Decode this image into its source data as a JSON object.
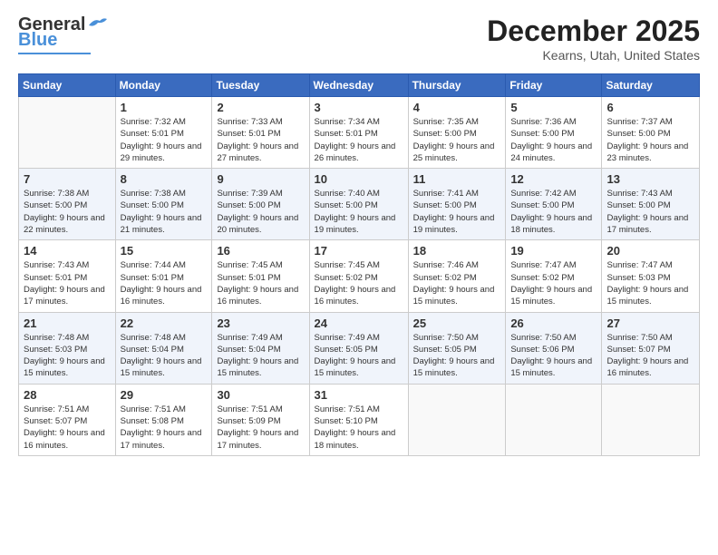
{
  "header": {
    "logo_general": "General",
    "logo_blue": "Blue",
    "month": "December 2025",
    "location": "Kearns, Utah, United States"
  },
  "days_of_week": [
    "Sunday",
    "Monday",
    "Tuesday",
    "Wednesday",
    "Thursday",
    "Friday",
    "Saturday"
  ],
  "weeks": [
    [
      {
        "day": "",
        "sunrise": "",
        "sunset": "",
        "daylight": ""
      },
      {
        "day": "1",
        "sunrise": "Sunrise: 7:32 AM",
        "sunset": "Sunset: 5:01 PM",
        "daylight": "Daylight: 9 hours and 29 minutes."
      },
      {
        "day": "2",
        "sunrise": "Sunrise: 7:33 AM",
        "sunset": "Sunset: 5:01 PM",
        "daylight": "Daylight: 9 hours and 27 minutes."
      },
      {
        "day": "3",
        "sunrise": "Sunrise: 7:34 AM",
        "sunset": "Sunset: 5:01 PM",
        "daylight": "Daylight: 9 hours and 26 minutes."
      },
      {
        "day": "4",
        "sunrise": "Sunrise: 7:35 AM",
        "sunset": "Sunset: 5:00 PM",
        "daylight": "Daylight: 9 hours and 25 minutes."
      },
      {
        "day": "5",
        "sunrise": "Sunrise: 7:36 AM",
        "sunset": "Sunset: 5:00 PM",
        "daylight": "Daylight: 9 hours and 24 minutes."
      },
      {
        "day": "6",
        "sunrise": "Sunrise: 7:37 AM",
        "sunset": "Sunset: 5:00 PM",
        "daylight": "Daylight: 9 hours and 23 minutes."
      }
    ],
    [
      {
        "day": "7",
        "sunrise": "Sunrise: 7:38 AM",
        "sunset": "Sunset: 5:00 PM",
        "daylight": "Daylight: 9 hours and 22 minutes."
      },
      {
        "day": "8",
        "sunrise": "Sunrise: 7:38 AM",
        "sunset": "Sunset: 5:00 PM",
        "daylight": "Daylight: 9 hours and 21 minutes."
      },
      {
        "day": "9",
        "sunrise": "Sunrise: 7:39 AM",
        "sunset": "Sunset: 5:00 PM",
        "daylight": "Daylight: 9 hours and 20 minutes."
      },
      {
        "day": "10",
        "sunrise": "Sunrise: 7:40 AM",
        "sunset": "Sunset: 5:00 PM",
        "daylight": "Daylight: 9 hours and 19 minutes."
      },
      {
        "day": "11",
        "sunrise": "Sunrise: 7:41 AM",
        "sunset": "Sunset: 5:00 PM",
        "daylight": "Daylight: 9 hours and 19 minutes."
      },
      {
        "day": "12",
        "sunrise": "Sunrise: 7:42 AM",
        "sunset": "Sunset: 5:00 PM",
        "daylight": "Daylight: 9 hours and 18 minutes."
      },
      {
        "day": "13",
        "sunrise": "Sunrise: 7:43 AM",
        "sunset": "Sunset: 5:00 PM",
        "daylight": "Daylight: 9 hours and 17 minutes."
      }
    ],
    [
      {
        "day": "14",
        "sunrise": "Sunrise: 7:43 AM",
        "sunset": "Sunset: 5:01 PM",
        "daylight": "Daylight: 9 hours and 17 minutes."
      },
      {
        "day": "15",
        "sunrise": "Sunrise: 7:44 AM",
        "sunset": "Sunset: 5:01 PM",
        "daylight": "Daylight: 9 hours and 16 minutes."
      },
      {
        "day": "16",
        "sunrise": "Sunrise: 7:45 AM",
        "sunset": "Sunset: 5:01 PM",
        "daylight": "Daylight: 9 hours and 16 minutes."
      },
      {
        "day": "17",
        "sunrise": "Sunrise: 7:45 AM",
        "sunset": "Sunset: 5:02 PM",
        "daylight": "Daylight: 9 hours and 16 minutes."
      },
      {
        "day": "18",
        "sunrise": "Sunrise: 7:46 AM",
        "sunset": "Sunset: 5:02 PM",
        "daylight": "Daylight: 9 hours and 15 minutes."
      },
      {
        "day": "19",
        "sunrise": "Sunrise: 7:47 AM",
        "sunset": "Sunset: 5:02 PM",
        "daylight": "Daylight: 9 hours and 15 minutes."
      },
      {
        "day": "20",
        "sunrise": "Sunrise: 7:47 AM",
        "sunset": "Sunset: 5:03 PM",
        "daylight": "Daylight: 9 hours and 15 minutes."
      }
    ],
    [
      {
        "day": "21",
        "sunrise": "Sunrise: 7:48 AM",
        "sunset": "Sunset: 5:03 PM",
        "daylight": "Daylight: 9 hours and 15 minutes."
      },
      {
        "day": "22",
        "sunrise": "Sunrise: 7:48 AM",
        "sunset": "Sunset: 5:04 PM",
        "daylight": "Daylight: 9 hours and 15 minutes."
      },
      {
        "day": "23",
        "sunrise": "Sunrise: 7:49 AM",
        "sunset": "Sunset: 5:04 PM",
        "daylight": "Daylight: 9 hours and 15 minutes."
      },
      {
        "day": "24",
        "sunrise": "Sunrise: 7:49 AM",
        "sunset": "Sunset: 5:05 PM",
        "daylight": "Daylight: 9 hours and 15 minutes."
      },
      {
        "day": "25",
        "sunrise": "Sunrise: 7:50 AM",
        "sunset": "Sunset: 5:05 PM",
        "daylight": "Daylight: 9 hours and 15 minutes."
      },
      {
        "day": "26",
        "sunrise": "Sunrise: 7:50 AM",
        "sunset": "Sunset: 5:06 PM",
        "daylight": "Daylight: 9 hours and 15 minutes."
      },
      {
        "day": "27",
        "sunrise": "Sunrise: 7:50 AM",
        "sunset": "Sunset: 5:07 PM",
        "daylight": "Daylight: 9 hours and 16 minutes."
      }
    ],
    [
      {
        "day": "28",
        "sunrise": "Sunrise: 7:51 AM",
        "sunset": "Sunset: 5:07 PM",
        "daylight": "Daylight: 9 hours and 16 minutes."
      },
      {
        "day": "29",
        "sunrise": "Sunrise: 7:51 AM",
        "sunset": "Sunset: 5:08 PM",
        "daylight": "Daylight: 9 hours and 17 minutes."
      },
      {
        "day": "30",
        "sunrise": "Sunrise: 7:51 AM",
        "sunset": "Sunset: 5:09 PM",
        "daylight": "Daylight: 9 hours and 17 minutes."
      },
      {
        "day": "31",
        "sunrise": "Sunrise: 7:51 AM",
        "sunset": "Sunset: 5:10 PM",
        "daylight": "Daylight: 9 hours and 18 minutes."
      },
      {
        "day": "",
        "sunrise": "",
        "sunset": "",
        "daylight": ""
      },
      {
        "day": "",
        "sunrise": "",
        "sunset": "",
        "daylight": ""
      },
      {
        "day": "",
        "sunrise": "",
        "sunset": "",
        "daylight": ""
      }
    ]
  ]
}
